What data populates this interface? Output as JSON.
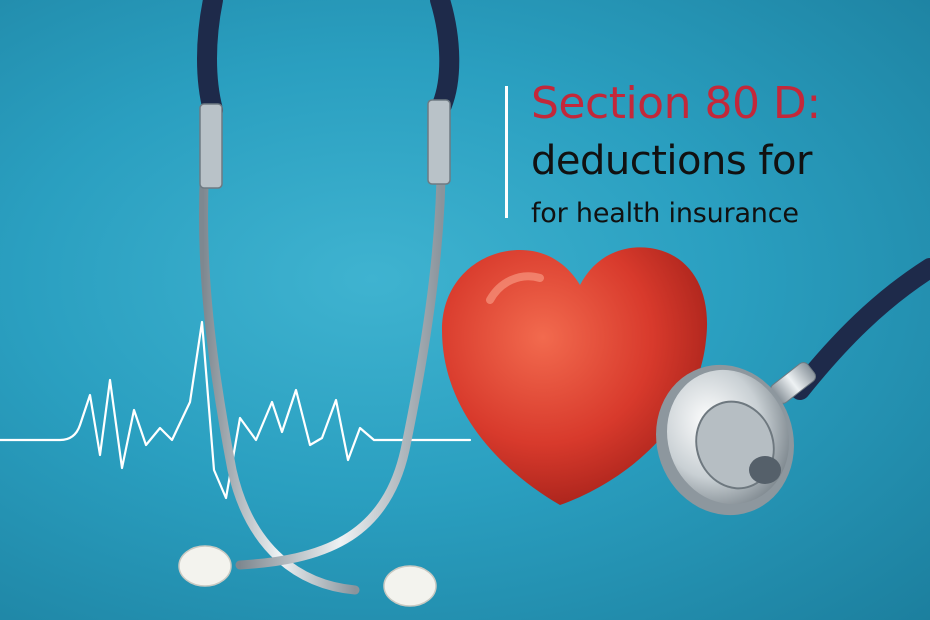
{
  "headline": {
    "line1": "Section 80 D:",
    "line2": "deductions for",
    "line3": "for health insurance"
  },
  "colors": {
    "background": "#2a9fc0",
    "headline_accent": "#c3283a",
    "headline_text": "#111111",
    "heart": "#d83a2c",
    "tubing": "#1e2a4a"
  },
  "icons": [
    "stethoscope-icon",
    "heart-icon",
    "heartbeat-line-icon"
  ]
}
